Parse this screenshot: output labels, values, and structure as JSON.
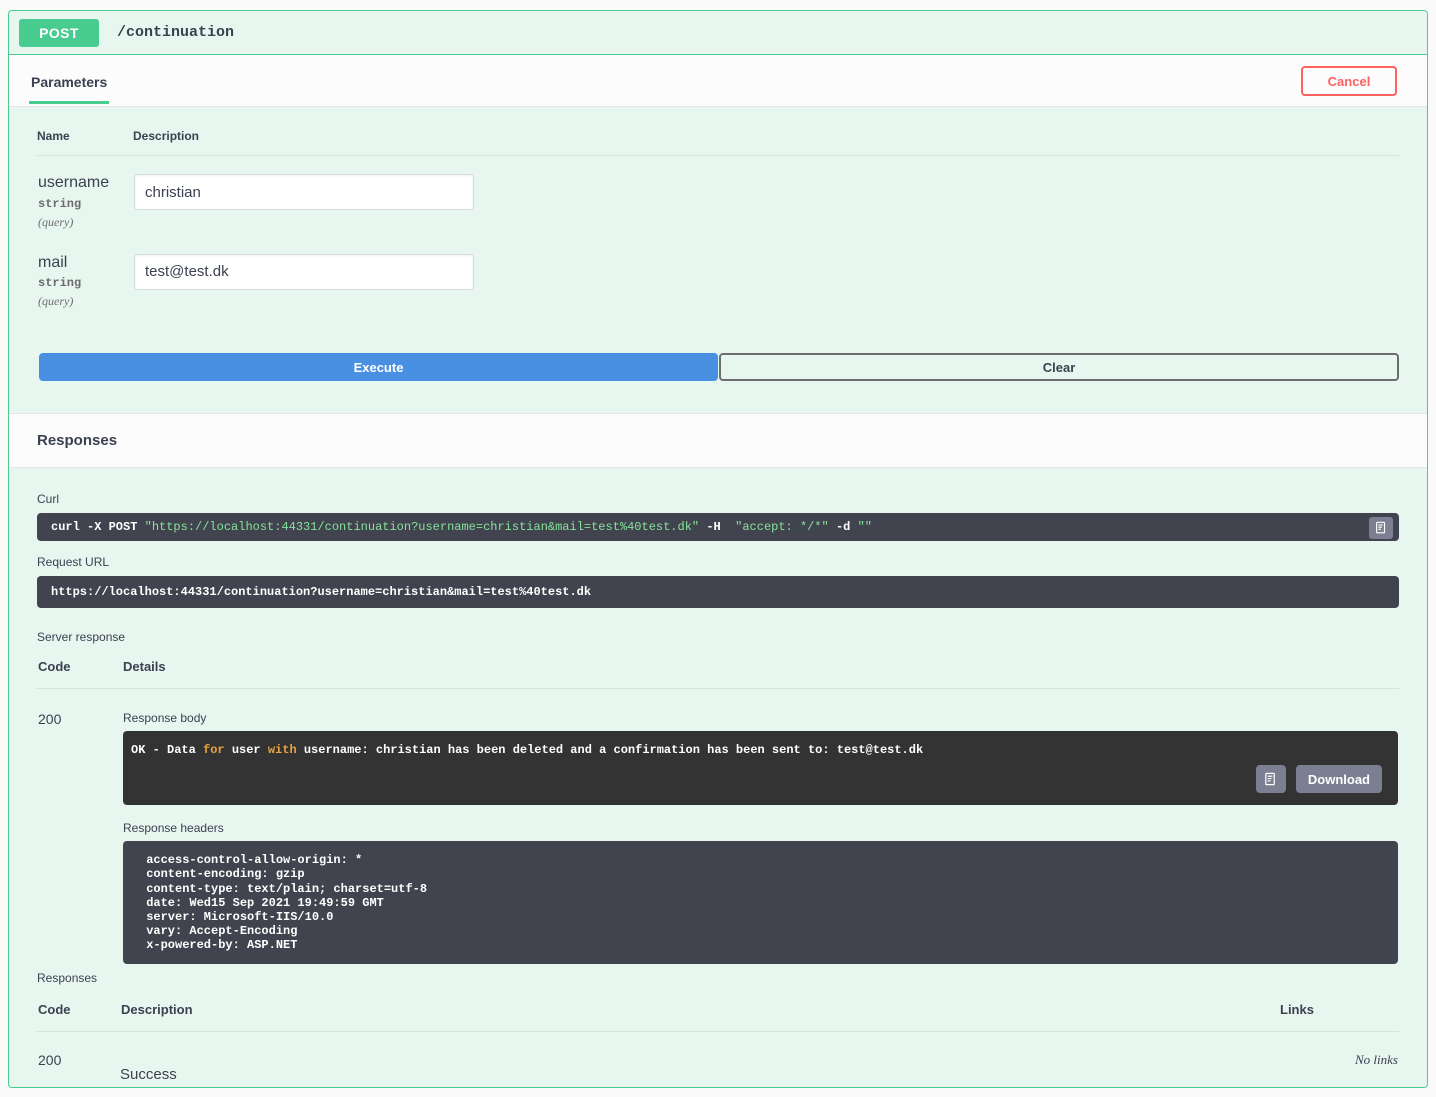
{
  "operation": {
    "method": "POST",
    "path": "/continuation"
  },
  "tabs": [
    {
      "label": "Parameters",
      "active": true
    }
  ],
  "cancel_label": "Cancel",
  "parameters": {
    "headers": {
      "name": "Name",
      "description": "Description"
    },
    "rows": [
      {
        "name": "username",
        "type": "string",
        "in": "(query)",
        "value": "christian",
        "placeholder": "username"
      },
      {
        "name": "mail",
        "type": "string",
        "in": "(query)",
        "value": "test@test.dk",
        "placeholder": "mail"
      }
    ]
  },
  "actions": {
    "execute_label": "Execute",
    "clear_label": "Clear"
  },
  "responses_section": {
    "title": "Responses"
  },
  "live_response": {
    "curl_label": "Curl",
    "curl_prefix": "curl -X POST ",
    "curl_url": "\"https://localhost:44331/continuation?username=christian&mail=test%40test.dk\"",
    "curl_middle": " -H  ",
    "curl_accept": "\"accept: */*\"",
    "curl_suffix": " -d ",
    "curl_empty": "\"\"",
    "copy_icon": "clipboard-copy-icon",
    "request_url_label": "Request URL",
    "request_url": "https://localhost:44331/continuation?username=christian&mail=test%40test.dk",
    "server_response_label": "Server response",
    "headers": {
      "code": "Code",
      "details": "Details"
    },
    "code": "200",
    "response_body_label": "Response body",
    "response_body": {
      "seg1": "OK - Data ",
      "kw1": "for",
      "seg2": " user ",
      "kw2": "with",
      "seg3": " username: christian has been deleted and a confirmation has been sent to: test@test.dk"
    },
    "download_label": "Download",
    "download_copy_icon": "clipboard-copy-icon",
    "response_headers_label": "Response headers",
    "response_headers": " access-control-allow-origin: * \n content-encoding: gzip \n content-type: text/plain; charset=utf-8 \n date: Wed15 Sep 2021 19:49:59 GMT \n server: Microsoft-IIS/10.0 \n vary: Accept-Encoding \n x-powered-by: ASP.NET "
  },
  "documented_responses": {
    "title": "Responses",
    "headers": {
      "code": "Code",
      "description": "Description",
      "links": "Links"
    },
    "rows": [
      {
        "code": "200",
        "description": "Success",
        "links": "No links"
      }
    ]
  },
  "colors": {
    "method_green": "#49cc90",
    "block_bg": "#e8f6f0",
    "execute_blue": "#4990e2",
    "cancel_red": "#ff6060",
    "code_dark": "#41444e",
    "body_dark": "#333333"
  }
}
